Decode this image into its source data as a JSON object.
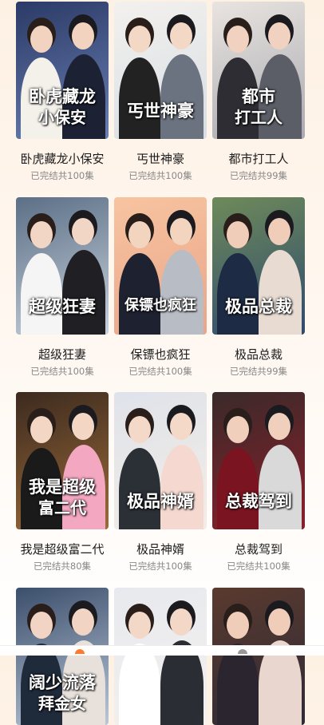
{
  "dramas": [
    {
      "title": "卧虎藏龙小保安",
      "status": "已完结共100集",
      "overlay_line1": "卧虎藏龙",
      "overlay_line2": "小保安",
      "colors": {
        "bg1": "#2b3a66",
        "bg2": "#6a7fb3",
        "fig1": "#f4f0ea",
        "fig2": "#1c2233",
        "skin": "#f2d3bf"
      }
    },
    {
      "title": "丐世神豪",
      "status": "已完结共100集",
      "overlay_line1": "丐世神豪",
      "overlay_line2": "",
      "colors": {
        "bg1": "#f3f1ee",
        "bg2": "#d8dde3",
        "fig1": "#222222",
        "fig2": "#6c7380",
        "skin": "#f4d8c6"
      }
    },
    {
      "title": "都市打工人",
      "status": "已完结共99集",
      "overlay_line1": "都市",
      "overlay_line2": "打工人",
      "colors": {
        "bg1": "#e9e4e0",
        "bg2": "#a9a9b0",
        "fig1": "#2d2d33",
        "fig2": "#5b5e66",
        "skin": "#f1d2c1"
      }
    },
    {
      "title": "超级狂妻",
      "status": "已完结共100集",
      "overlay_line1": "超级狂妻",
      "overlay_line2": "",
      "colors": {
        "bg1": "#5b6f86",
        "bg2": "#c9d2dc",
        "fig1": "#f5f5f5",
        "fig2": "#1f1f24",
        "skin": "#f2d6c5"
      }
    },
    {
      "title": "保镖也疯狂",
      "status": "已完结共100集",
      "overlay_line1": "保镖也疯狂",
      "overlay_line2": "",
      "colors": {
        "bg1": "#f7c4a1",
        "bg2": "#e9a588",
        "fig1": "#1e2230",
        "fig2": "#b8bcc4",
        "skin": "#f3d4bf"
      }
    },
    {
      "title": "极品总裁",
      "status": "已完结共99集",
      "overlay_line1": "极品总裁",
      "overlay_line2": "",
      "colors": {
        "bg1": "#6e8a5a",
        "bg2": "#2e4a6e",
        "fig1": "#1d2b44",
        "fig2": "#e8dcd2",
        "skin": "#efcdb9"
      }
    },
    {
      "title": "我是超级富二代",
      "status": "已完结共80集",
      "overlay_line1": "我是超级",
      "overlay_line2": "富二代",
      "colors": {
        "bg1": "#3c2a1e",
        "bg2": "#9b6b3a",
        "fig1": "#1a1a1a",
        "fig2": "#f3a7c0",
        "skin": "#f3d6c4"
      }
    },
    {
      "title": "极品神婿",
      "status": "已完结共100集",
      "overlay_line1": "极品神婿",
      "overlay_line2": "",
      "colors": {
        "bg1": "#dfe3ea",
        "bg2": "#f3ece6",
        "fig1": "#2b2f36",
        "fig2": "#f5d9d0",
        "skin": "#f4d8c8"
      }
    },
    {
      "title": "总裁驾到",
      "status": "已完结共100集",
      "overlay_line1": "总裁驾到",
      "overlay_line2": "",
      "colors": {
        "bg1": "#3a2a2a",
        "bg2": "#8a1f2a",
        "fig1": "#7a1420",
        "fig2": "#d9d9d9",
        "skin": "#f0cfbc"
      }
    },
    {
      "title": "",
      "status": "",
      "overlay_line1": "阔少流落",
      "overlay_line2": "拜金女",
      "colors": {
        "bg1": "#3b4e6b",
        "bg2": "#b9c7d8",
        "fig1": "#1f2a3a",
        "fig2": "#e8e0da",
        "skin": "#f1d4c3"
      }
    },
    {
      "title": "",
      "status": "",
      "overlay_line1": "",
      "overlay_line2": "",
      "colors": {
        "bg1": "#e7e9ee",
        "bg2": "#f4f1ee",
        "fig1": "#ffffff",
        "fig2": "#2a2d33",
        "skin": "#f3d7c7"
      }
    },
    {
      "title": "",
      "status": "",
      "overlay_line1": "",
      "overlay_line2": "",
      "colors": {
        "bg1": "#5a3a2e",
        "bg2": "#2f2a36",
        "fig1": "#2b2530",
        "fig2": "#e9d7cf",
        "skin": "#efcdb8"
      }
    }
  ],
  "bottom_nav": {
    "accent": "#ff7a2b"
  }
}
